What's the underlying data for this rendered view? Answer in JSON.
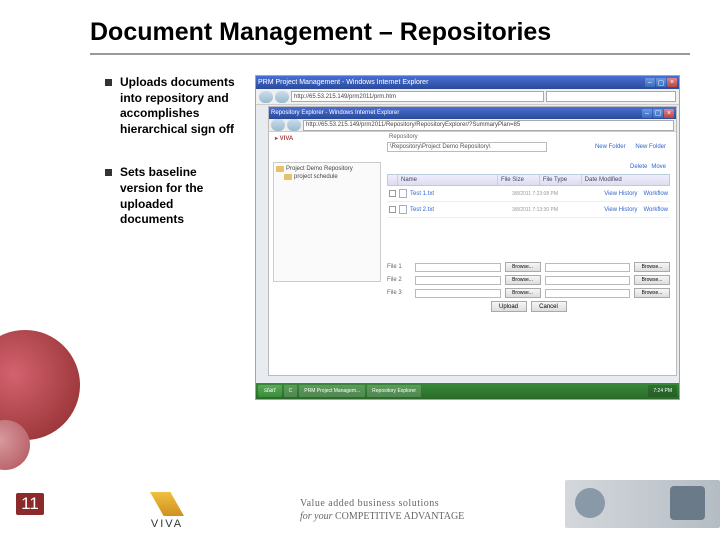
{
  "title": "Document Management – Repositories",
  "bullets": [
    "Uploads documents into repository and accomplishes hierarchical sign off",
    "Sets baseline version for the uploaded documents"
  ],
  "page_number": "11",
  "screenshot": {
    "outer_title": "PRM Project Management - Windows Internet Explorer",
    "outer_url": "http://65.53.215.149/prm2011/prm.htm",
    "inner_title": "Repository Explorer - Windows Internet Explorer",
    "inner_url": "http://65.53.215.149/prm2011/Repository/RepositoryExplorer/?SummaryPlan=85",
    "repo_label": "Repository",
    "repo_value": "\\Repository\\Project Demo Repository\\",
    "link_new_folder": "New Folder",
    "link_new_doc": "New Folder",
    "tree_root": "Project Demo Repository",
    "tree_items": [
      "project schedule"
    ],
    "hdr_delete": "Delete",
    "hdr_move": "Move",
    "columns": {
      "name": "Name",
      "size": "File Size",
      "type": "File Type",
      "date": "Date Modified"
    },
    "rows": [
      {
        "name": "Test 1.txt",
        "date": "3/8/2011 7:23:08 PM"
      },
      {
        "name": "Test 2.txt",
        "date": "3/8/2011 7:13:30 PM"
      }
    ],
    "action_history": "View History",
    "action_workflow": "Workflow",
    "upload_labels": [
      "File 1",
      "File 2",
      "File 3"
    ],
    "browse": "Browse...",
    "btn_upload": "Upload",
    "btn_cancel": "Cancel",
    "start": "start",
    "taskbar": [
      "C",
      "PRM Project Managem...",
      "Repository Explorer"
    ],
    "tray_time": "7:24 PM"
  },
  "footer": {
    "logo": "VIVA",
    "tag1": "Value added business solutions",
    "tag2_a": "for your",
    "tag2_b": "COMPETITIVE ADVANTAGE"
  }
}
